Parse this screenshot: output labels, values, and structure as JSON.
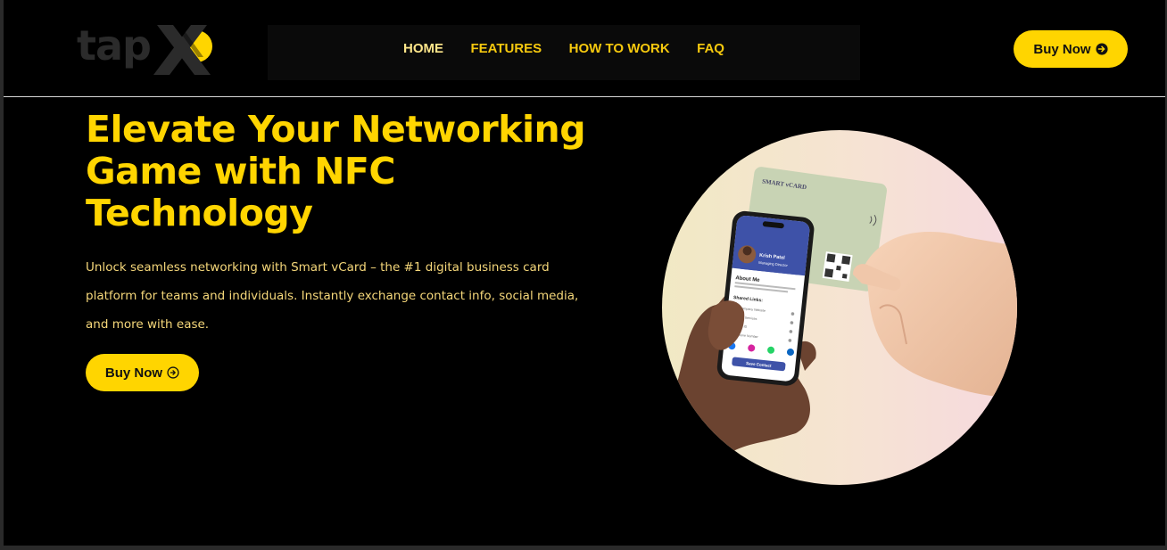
{
  "header": {
    "logo": {
      "text": "tap",
      "mark": "X"
    },
    "nav": [
      {
        "label": "HOME"
      },
      {
        "label": "FEATURES"
      },
      {
        "label": "HOW TO WORK"
      },
      {
        "label": "FAQ"
      }
    ],
    "buy_label": "Buy Now"
  },
  "hero": {
    "title": "Elevate Your Networking Game with NFC Technology",
    "description": "Unlock seamless networking with Smart vCard – the #1 digital business card platform for teams and individuals. Instantly exchange contact info, social media, and more with ease.",
    "buy_label": "Buy Now"
  },
  "image": {
    "card_brand": "SMART vCARD",
    "profile_name": "Krish Patel",
    "profile_role": "Managing Director",
    "about_heading": "About Me",
    "about_text": "Lorem ipsum is simply dummy text of the printing and typesetting industry.",
    "links_heading": "Shared Links:",
    "links": [
      "Company Website",
      "Our Services",
      "Wifi ID",
      "Phone Number"
    ],
    "save_label": "Save Contact"
  },
  "colors": {
    "accent": "#ffd500",
    "background": "#000000",
    "nav_text": "#f6c90e"
  },
  "icons": {
    "buy_arrow": "arrow-right-circle-icon"
  }
}
